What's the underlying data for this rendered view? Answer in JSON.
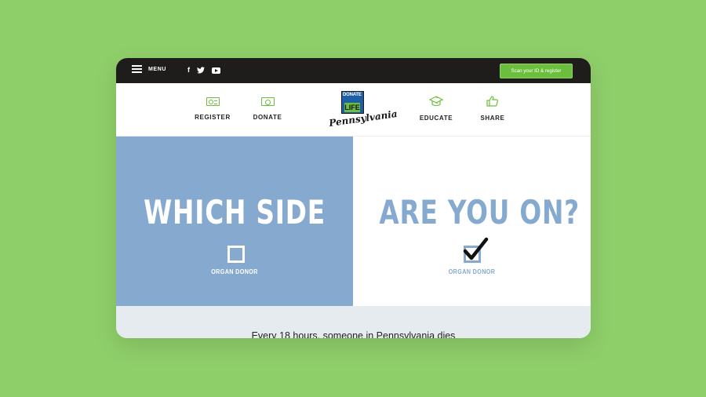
{
  "topbar": {
    "menu_label": "MENU",
    "social_icons": [
      "facebook-icon",
      "twitter-icon",
      "youtube-icon"
    ],
    "cta_label": "Scan your ID & register"
  },
  "nav": {
    "items": [
      {
        "label": "REGISTER",
        "icon": "id-card-icon"
      },
      {
        "label": "DONATE",
        "icon": "money-icon"
      },
      {
        "label": "EDUCATE",
        "icon": "graduation-cap-icon"
      },
      {
        "label": "SHARE",
        "icon": "thumbs-up-icon"
      }
    ],
    "logo": {
      "top": "DONATE",
      "middle": "LIFE",
      "script": "Pennsylvania"
    }
  },
  "hero": {
    "left_headline": "WHICH SIDE",
    "right_headline": "ARE YOU ON?",
    "left_caption": "ORGAN DONOR",
    "right_caption": "ORGAN DONOR"
  },
  "bottom": {
    "text": "Every 18 hours, someone in Pennsylvania dies"
  },
  "colors": {
    "background": "#8fcf6a",
    "accent_green": "#6cbf3c",
    "hero_blue": "#85a9cf",
    "topbar": "#1f1c1c"
  }
}
